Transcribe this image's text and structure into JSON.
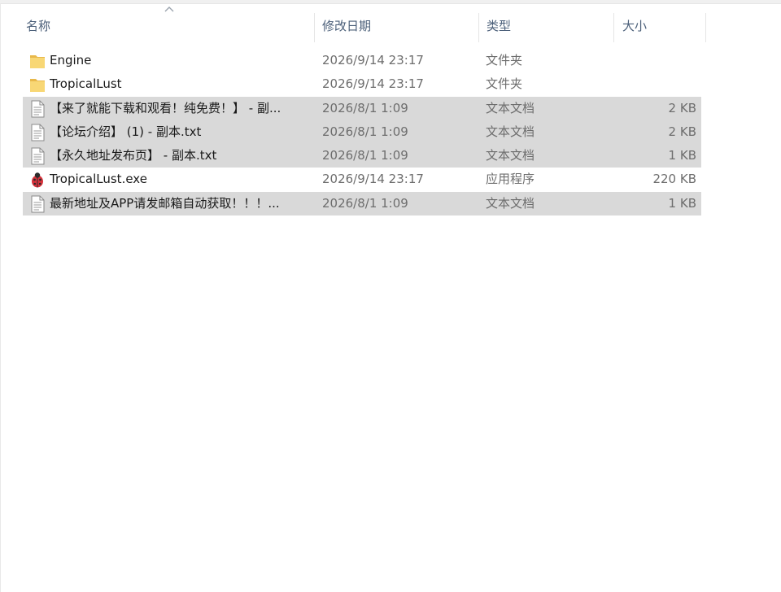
{
  "columns": {
    "name": "名称",
    "date": "修改日期",
    "type": "类型",
    "size": "大小"
  },
  "files": [
    {
      "name": "Engine",
      "date": "2026/9/14 23:17",
      "type": "文件夹",
      "size": "",
      "icon": "folder-icon",
      "selected": false
    },
    {
      "name": "TropicalLust",
      "date": "2026/9/14 23:17",
      "type": "文件夹",
      "size": "",
      "icon": "folder-icon",
      "selected": false
    },
    {
      "name": "【来了就能下载和观看！纯免费！】 - 副...",
      "date": "2026/8/1 1:09",
      "type": "文本文档",
      "size": "2 KB",
      "icon": "text-file-icon",
      "selected": true
    },
    {
      "name": "【论坛介绍】 (1) - 副本.txt",
      "date": "2026/8/1 1:09",
      "type": "文本文档",
      "size": "2 KB",
      "icon": "text-file-icon",
      "selected": true
    },
    {
      "name": "【永久地址发布页】 - 副本.txt",
      "date": "2026/8/1 1:09",
      "type": "文本文档",
      "size": "1 KB",
      "icon": "text-file-icon",
      "selected": true
    },
    {
      "name": "TropicalLust.exe",
      "date": "2026/9/14 23:17",
      "type": "应用程序",
      "size": "220 KB",
      "icon": "ladybug-app-icon",
      "selected": false
    },
    {
      "name": "最新地址及APP请发邮箱自动获取！！！...",
      "date": "2026/8/1 1:09",
      "type": "文本文档",
      "size": "1 KB",
      "icon": "text-file-icon",
      "selected": true
    }
  ],
  "colors": {
    "header_text": "#4c607a",
    "selection": "#d9d9d9",
    "folder": "#f8d775",
    "secondary_text": "#6d6d6d"
  }
}
